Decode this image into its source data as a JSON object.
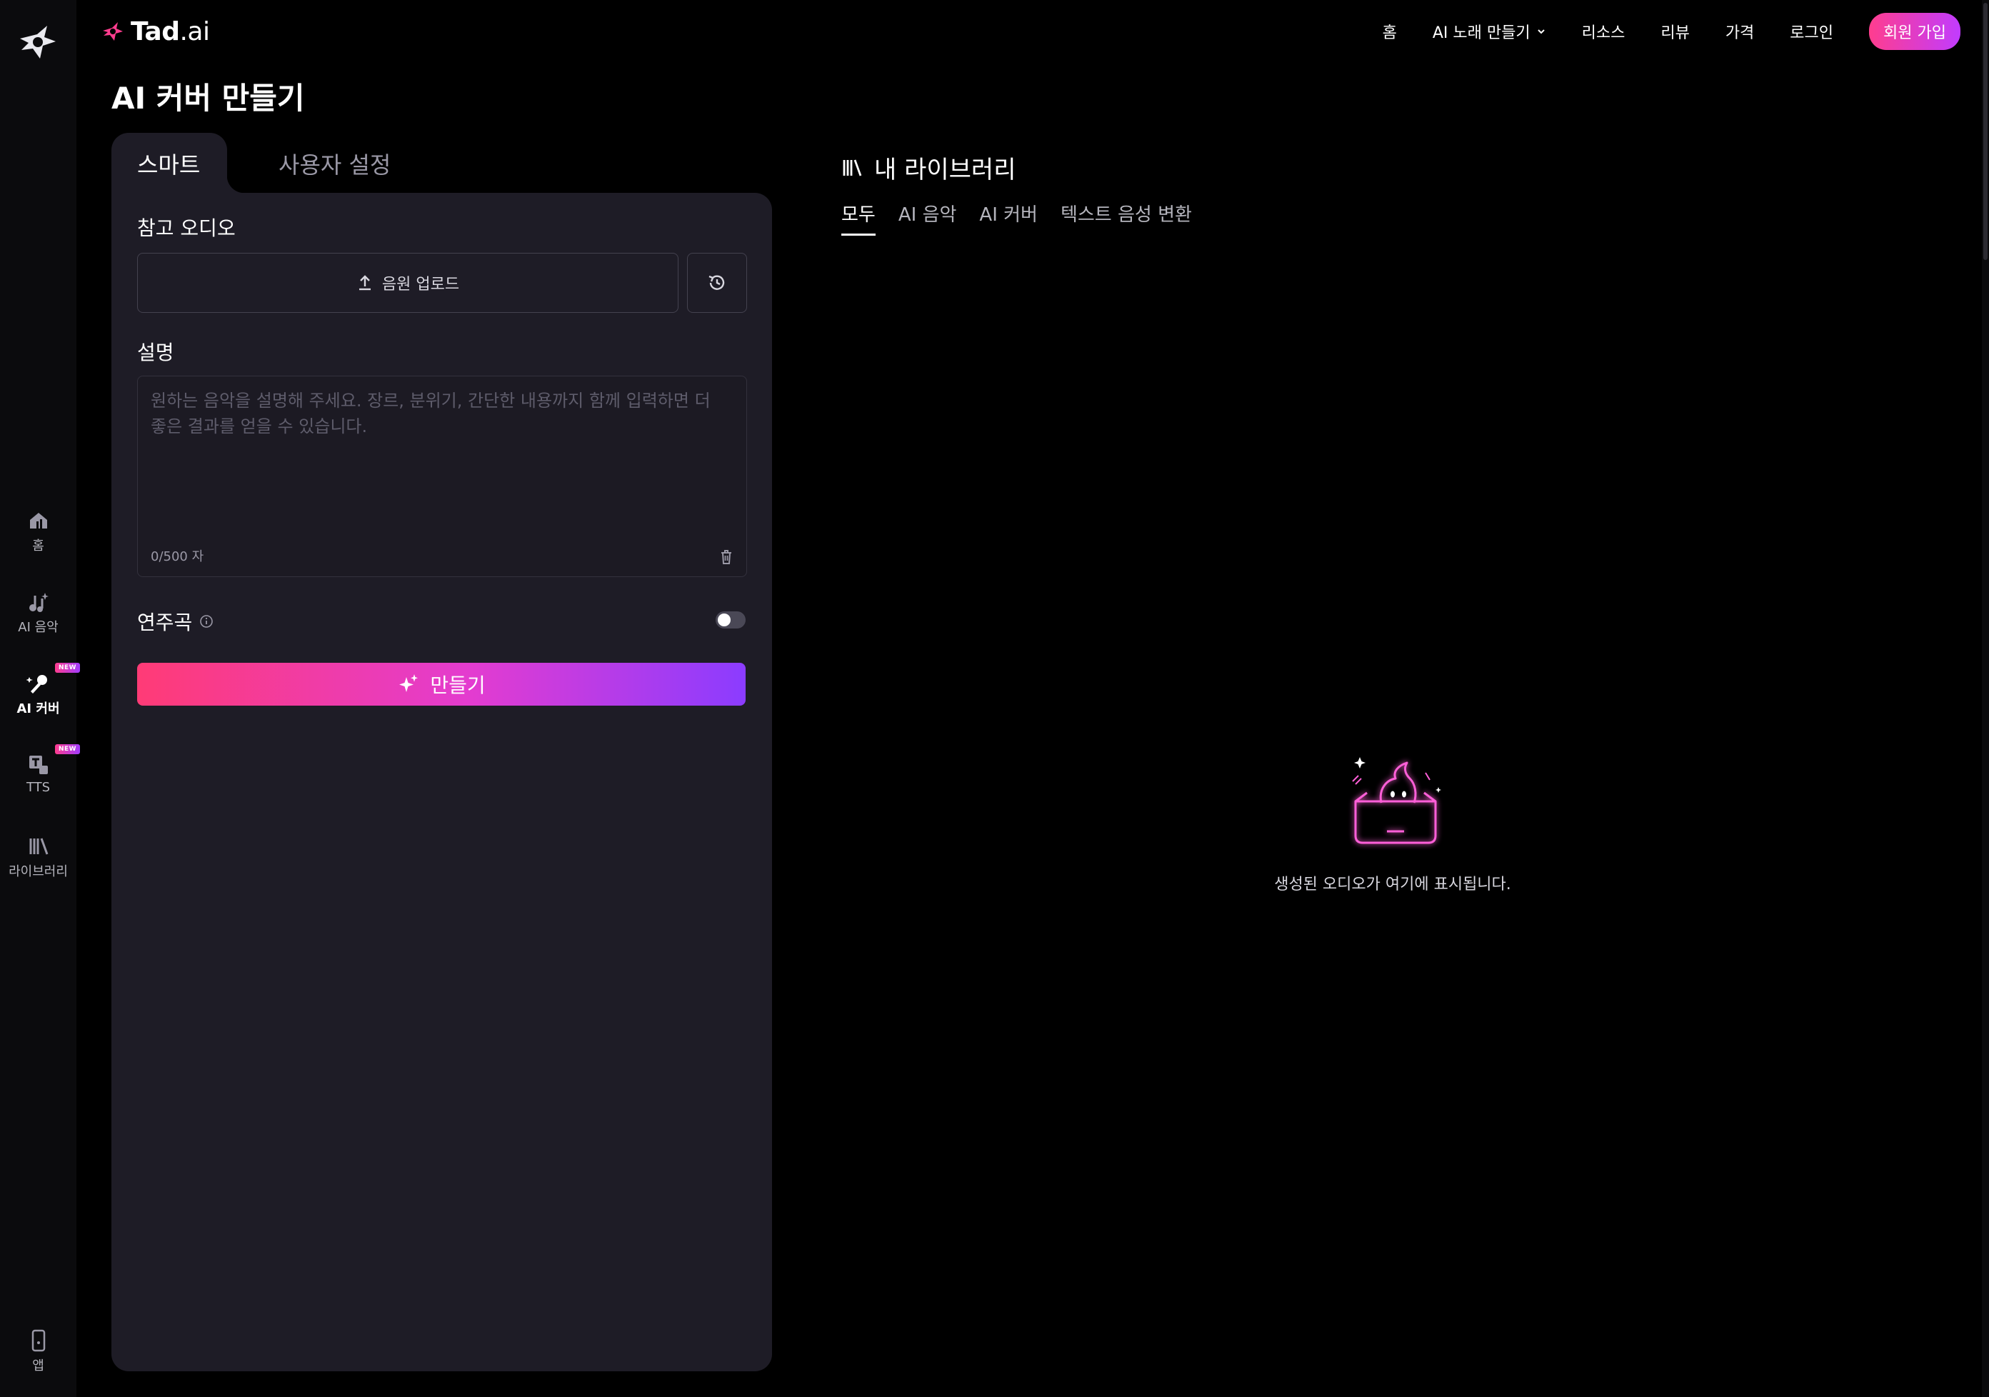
{
  "brand": {
    "name": "Tad",
    "suffix": ".ai"
  },
  "nav": {
    "home": "홈",
    "make_song": "AI 노래 만들기",
    "resources": "리소스",
    "reviews": "리뷰",
    "pricing": "가격",
    "login": "로그인",
    "signup": "회원 가입"
  },
  "rail": {
    "home": "홈",
    "ai_music": "AI 음악",
    "ai_cover": "AI 커버",
    "tts": "TTS",
    "library": "라이브러리",
    "app": "앱",
    "new_badge": "NEW"
  },
  "page": {
    "title": "AI 커버 만들기"
  },
  "mode_tabs": {
    "smart": "스마트",
    "custom": "사용자 설정"
  },
  "form": {
    "ref_audio_label": "참고 오디오",
    "upload_label": "음원 업로드",
    "description_label": "설명",
    "description_placeholder": "원하는 음악을 설명해 주세요. 장르, 분위기, 간단한 내용까지 함께 입력하면 더 좋은 결과를 얻을 수 있습니다.",
    "char_count": "0/500 자",
    "instrumental_label": "연주곡",
    "instrumental_on": false,
    "create_label": "만들기"
  },
  "library": {
    "title": "내 라이브러리",
    "tabs": [
      "모두",
      "AI 음악",
      "AI 커버",
      "텍스트 음성 변환"
    ],
    "active_tab": 0,
    "empty_text": "생성된 오디오가 여기에 표시됩니다."
  },
  "colors": {
    "panel": "#1e1c26",
    "accent_pink": "#ff3d8e",
    "accent_purple": "#8b3cff"
  }
}
